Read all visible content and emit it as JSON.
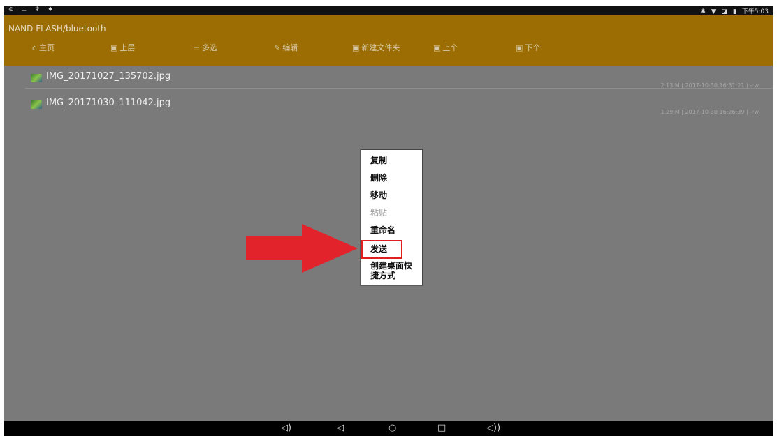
{
  "statusbar": {
    "left_icons": "⊙ ⊥ ♆ ♦",
    "bluetooth": "✱",
    "wifi": "▼",
    "sim": "◪",
    "battery": "▮",
    "time": "下午5:03"
  },
  "header": {
    "path": "NAND FLASH/bluetooth"
  },
  "toolbar": [
    {
      "label": "主页",
      "icon": "home-icon",
      "glyph": "⌂"
    },
    {
      "label": "上层",
      "icon": "folder-up-icon",
      "glyph": "▣"
    },
    {
      "label": "多选",
      "icon": "multiselect-icon",
      "glyph": "☰"
    },
    {
      "label": "编辑",
      "icon": "edit-icon",
      "glyph": "✎"
    },
    {
      "label": "新建文件夹",
      "icon": "new-folder-icon",
      "glyph": "▣"
    },
    {
      "label": "上个",
      "icon": "previous-icon",
      "glyph": "▣"
    },
    {
      "label": "下个",
      "icon": "next-icon",
      "glyph": "▣"
    }
  ],
  "files": [
    {
      "name": "IMG_20171027_135702.jpg",
      "meta": "2.13 M | 2017-10-30 16:31:21 | -rw"
    },
    {
      "name": "IMG_20171030_111042.jpg",
      "meta": "1.29 M | 2017-10-30 16:26:39 | -rw"
    }
  ],
  "context_menu": [
    {
      "label": "复制",
      "enabled": true
    },
    {
      "label": "删除",
      "enabled": true
    },
    {
      "label": "移动",
      "enabled": true
    },
    {
      "label": "粘贴",
      "enabled": false
    },
    {
      "label": "重命名",
      "enabled": true
    },
    {
      "label": "发送",
      "enabled": true
    },
    {
      "label": "创建桌面快",
      "enabled": true
    },
    {
      "label": "捷方式",
      "enabled": true
    }
  ],
  "navbar": {
    "vol_down": "◁)",
    "back": "◁",
    "home": "○",
    "recents": "□",
    "vol_up": "◁))"
  },
  "colors": {
    "accent": "#9b6d02",
    "background": "#7a7a7a",
    "highlight": "#e02020"
  }
}
